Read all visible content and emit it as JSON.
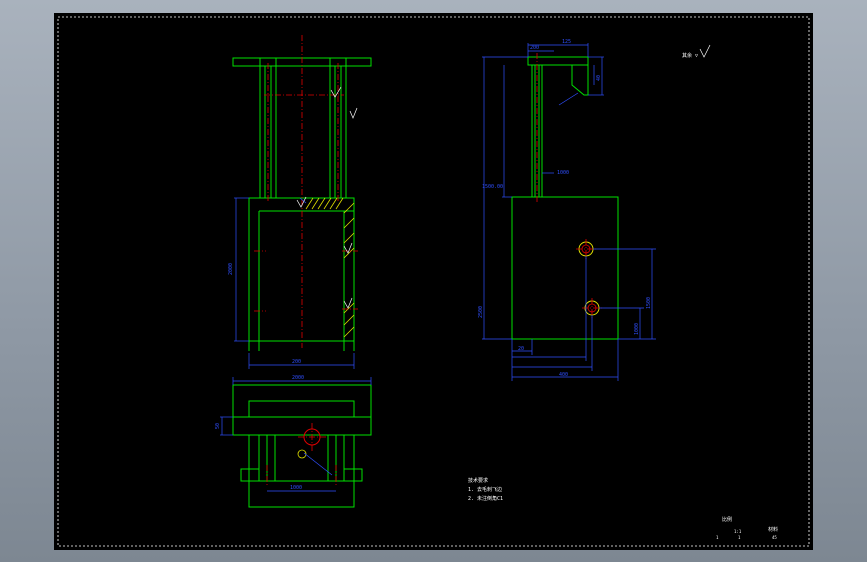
{
  "notes": {
    "title": "技术要求",
    "line1": "1. 去毛刺飞边",
    "line2": "2. 未注倒角C1"
  },
  "roughness_symbol": "其余 ▽",
  "title_block": {
    "label_a": "比例",
    "label_b": "材料",
    "cell_1": "1:1",
    "cell_2": "1",
    "cell_3": "1",
    "cell_4": "45"
  },
  "dims": {
    "front_height": "2000",
    "front_width": "200",
    "top_width": "2000",
    "top_inner": "1000",
    "top_height": "50",
    "side_height": "2500",
    "side_shaft": "1000",
    "side_head": "125",
    "side_width": "400",
    "side_hole1": "1000",
    "side_hole2": "1500",
    "side_base": "20",
    "side_small": "40",
    "side_offset": "1500.00",
    "side_top": "200"
  },
  "colors": {
    "outline": "#00e000",
    "dimension": "#2f4fff",
    "centerline": "#e00000",
    "frame": "#ffffff",
    "hatch": "#e0e000"
  }
}
